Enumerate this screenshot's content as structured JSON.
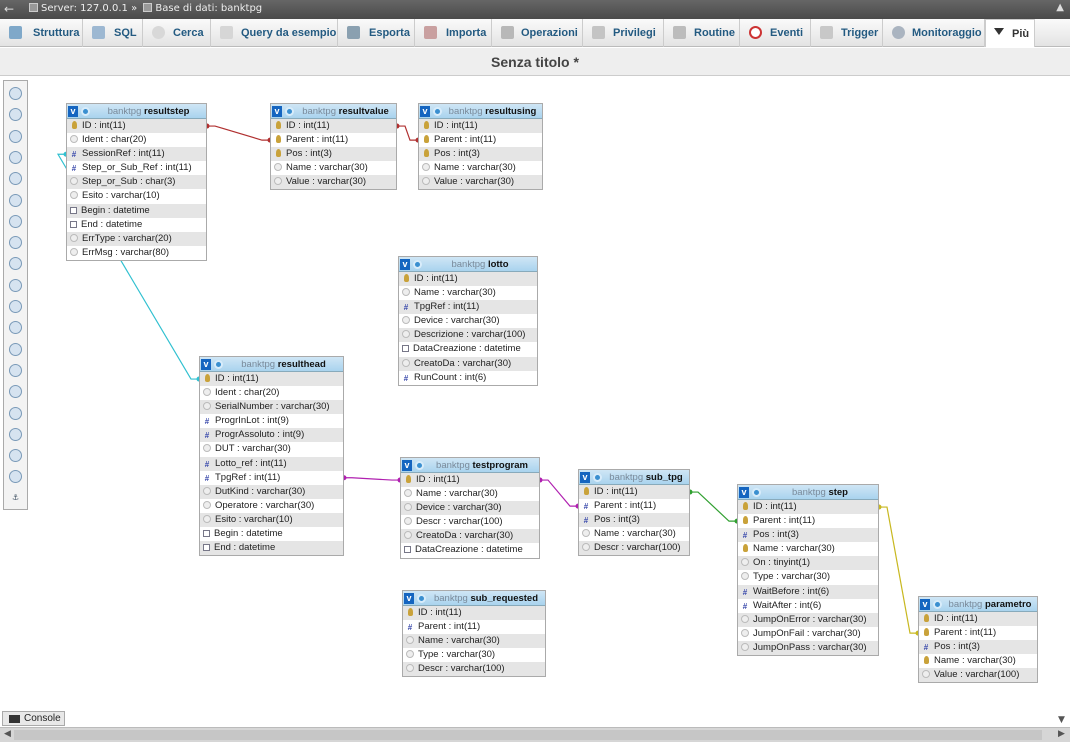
{
  "window": {
    "server_label": "Server: 127.0.0.1",
    "separator": "»",
    "db_label": "Base di dati: banktpg"
  },
  "tabs": [
    {
      "label": "Struttura",
      "icon": "structure-icon"
    },
    {
      "label": "SQL",
      "icon": "sql-icon"
    },
    {
      "label": "Cerca",
      "icon": "search-icon"
    },
    {
      "label": "Query da esempio",
      "icon": "query-icon"
    },
    {
      "label": "Esporta",
      "icon": "export-icon"
    },
    {
      "label": "Importa",
      "icon": "import-icon"
    },
    {
      "label": "Operazioni",
      "icon": "wrench-icon"
    },
    {
      "label": "Privilegi",
      "icon": "privileges-icon"
    },
    {
      "label": "Routine",
      "icon": "routines-icon"
    },
    {
      "label": "Eventi",
      "icon": "clock-icon"
    },
    {
      "label": "Trigger",
      "icon": "trigger-icon"
    },
    {
      "label": "Monitoraggio",
      "icon": "eye-icon"
    },
    {
      "label": "Più",
      "icon": "caret-down-icon"
    }
  ],
  "page_title": "Senza titolo *",
  "console_label": "Console",
  "colors": {
    "link_resultstep_resultvalue": "#b03030",
    "link_resultvalue_resultusing": "#b03030",
    "link_resultstep_resulthead": "#30c0d0",
    "link_resulthead_testprogram": "#b020b0",
    "link_testprogram_sub_tpg": "#b020b0",
    "link_sub_tpg_step": "#30a030",
    "link_step_parametro": "#c8b820"
  },
  "tables": [
    {
      "db": "banktpg",
      "name": "resultstep",
      "fields": [
        {
          "t": "key",
          "text": "ID : int(11)"
        },
        {
          "t": "str",
          "text": "Ident : char(20)"
        },
        {
          "t": "num",
          "text": "SessionRef : int(11)"
        },
        {
          "t": "num",
          "text": "Step_or_Sub_Ref : int(11)"
        },
        {
          "t": "str",
          "text": "Step_or_Sub : char(3)"
        },
        {
          "t": "str",
          "text": "Esito : varchar(10)"
        },
        {
          "t": "dt",
          "text": "Begin : datetime"
        },
        {
          "t": "dt",
          "text": "End : datetime"
        },
        {
          "t": "str",
          "text": "ErrType : varchar(20)"
        },
        {
          "t": "str",
          "text": "ErrMsg : varchar(80)"
        }
      ]
    },
    {
      "db": "banktpg",
      "name": "resultvalue",
      "fields": [
        {
          "t": "key",
          "text": "ID : int(11)"
        },
        {
          "t": "key",
          "text": "Parent : int(11)"
        },
        {
          "t": "key",
          "text": "Pos : int(3)"
        },
        {
          "t": "str",
          "text": "Name : varchar(30)"
        },
        {
          "t": "str",
          "text": "Value : varchar(30)"
        }
      ]
    },
    {
      "db": "banktpg",
      "name": "resultusing",
      "fields": [
        {
          "t": "key",
          "text": "ID : int(11)"
        },
        {
          "t": "key",
          "text": "Parent : int(11)"
        },
        {
          "t": "key",
          "text": "Pos : int(3)"
        },
        {
          "t": "str",
          "text": "Name : varchar(30)"
        },
        {
          "t": "str",
          "text": "Value : varchar(30)"
        }
      ]
    },
    {
      "db": "banktpg",
      "name": "lotto",
      "fields": [
        {
          "t": "key",
          "text": "ID : int(11)"
        },
        {
          "t": "str",
          "text": "Name : varchar(30)"
        },
        {
          "t": "num",
          "text": "TpgRef : int(11)"
        },
        {
          "t": "str",
          "text": "Device : varchar(30)"
        },
        {
          "t": "str",
          "text": "Descrizione : varchar(100)"
        },
        {
          "t": "dt",
          "text": "DataCreazione : datetime"
        },
        {
          "t": "str",
          "text": "CreatoDa : varchar(30)"
        },
        {
          "t": "num",
          "text": "RunCount : int(6)"
        }
      ]
    },
    {
      "db": "banktpg",
      "name": "resulthead",
      "fields": [
        {
          "t": "key",
          "text": "ID : int(11)"
        },
        {
          "t": "str",
          "text": "Ident : char(20)"
        },
        {
          "t": "str",
          "text": "SerialNumber : varchar(30)"
        },
        {
          "t": "num",
          "text": "ProgrInLot : int(9)"
        },
        {
          "t": "num",
          "text": "ProgrAssoluto : int(9)"
        },
        {
          "t": "str",
          "text": "DUT : varchar(30)"
        },
        {
          "t": "num",
          "text": "Lotto_ref : int(11)"
        },
        {
          "t": "num",
          "text": "TpgRef : int(11)"
        },
        {
          "t": "str",
          "text": "DutKind : varchar(30)"
        },
        {
          "t": "str",
          "text": "Operatore : varchar(30)"
        },
        {
          "t": "str",
          "text": "Esito : varchar(10)"
        },
        {
          "t": "dt",
          "text": "Begin : datetime"
        },
        {
          "t": "dt",
          "text": "End : datetime"
        }
      ]
    },
    {
      "db": "banktpg",
      "name": "testprogram",
      "fields": [
        {
          "t": "key",
          "text": "ID : int(11)"
        },
        {
          "t": "str",
          "text": "Name : varchar(30)"
        },
        {
          "t": "str",
          "text": "Device : varchar(30)"
        },
        {
          "t": "str",
          "text": "Descr : varchar(100)"
        },
        {
          "t": "str",
          "text": "CreatoDa : varchar(30)"
        },
        {
          "t": "dt",
          "text": "DataCreazione : datetime"
        }
      ]
    },
    {
      "db": "banktpg",
      "name": "sub_tpg",
      "fields": [
        {
          "t": "key",
          "text": "ID : int(11)"
        },
        {
          "t": "num",
          "text": "Parent : int(11)"
        },
        {
          "t": "num",
          "text": "Pos : int(3)"
        },
        {
          "t": "str",
          "text": "Name : varchar(30)"
        },
        {
          "t": "str",
          "text": "Descr : varchar(100)"
        }
      ]
    },
    {
      "db": "banktpg",
      "name": "step",
      "fields": [
        {
          "t": "key",
          "text": "ID : int(11)"
        },
        {
          "t": "key",
          "text": "Parent : int(11)"
        },
        {
          "t": "num",
          "text": "Pos : int(3)"
        },
        {
          "t": "key",
          "text": "Name : varchar(30)"
        },
        {
          "t": "str",
          "text": "On : tinyint(1)"
        },
        {
          "t": "str",
          "text": "Type : varchar(30)"
        },
        {
          "t": "num",
          "text": "WaitBefore : int(6)"
        },
        {
          "t": "num",
          "text": "WaitAfter : int(6)"
        },
        {
          "t": "str",
          "text": "JumpOnError : varchar(30)"
        },
        {
          "t": "str",
          "text": "JumpOnFail : varchar(30)"
        },
        {
          "t": "str",
          "text": "JumpOnPass : varchar(30)"
        }
      ]
    },
    {
      "db": "banktpg",
      "name": "sub_requested",
      "fields": [
        {
          "t": "key",
          "text": "ID : int(11)"
        },
        {
          "t": "num",
          "text": "Parent : int(11)"
        },
        {
          "t": "str",
          "text": "Name : varchar(30)"
        },
        {
          "t": "str",
          "text": "Type : varchar(30)"
        },
        {
          "t": "str",
          "text": "Descr : varchar(100)"
        }
      ]
    },
    {
      "db": "banktpg",
      "name": "parametro",
      "fields": [
        {
          "t": "key",
          "text": "ID : int(11)"
        },
        {
          "t": "key",
          "text": "Parent : int(11)"
        },
        {
          "t": "num",
          "text": "Pos : int(3)"
        },
        {
          "t": "key",
          "text": "Name : varchar(30)"
        },
        {
          "t": "str",
          "text": "Value : varchar(100)"
        }
      ]
    }
  ]
}
